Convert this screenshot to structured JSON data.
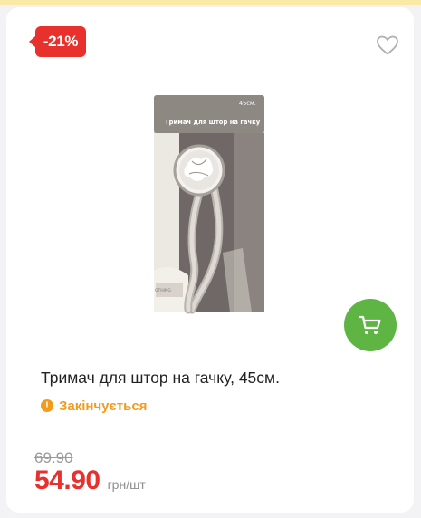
{
  "product": {
    "discount_badge": "-21%",
    "title": "Тримач для штор на гачку, 45см.",
    "status": "Закінчується",
    "old_price": "69.90",
    "price": "54.90",
    "unit": "грн/шт"
  },
  "packaging": {
    "size_label": "45см.",
    "heading": "Тримач для штор на гачку",
    "brand_fragment": "OTHING"
  },
  "icons": {
    "favorite": "heart-outline-icon",
    "cart": "shopping-cart-icon",
    "status": "exclamation-circle-icon"
  },
  "colors": {
    "discount": "#e8312c",
    "cart_button": "#5fb543",
    "status": "#f29b1d",
    "old_price": "#9a9a9a"
  }
}
